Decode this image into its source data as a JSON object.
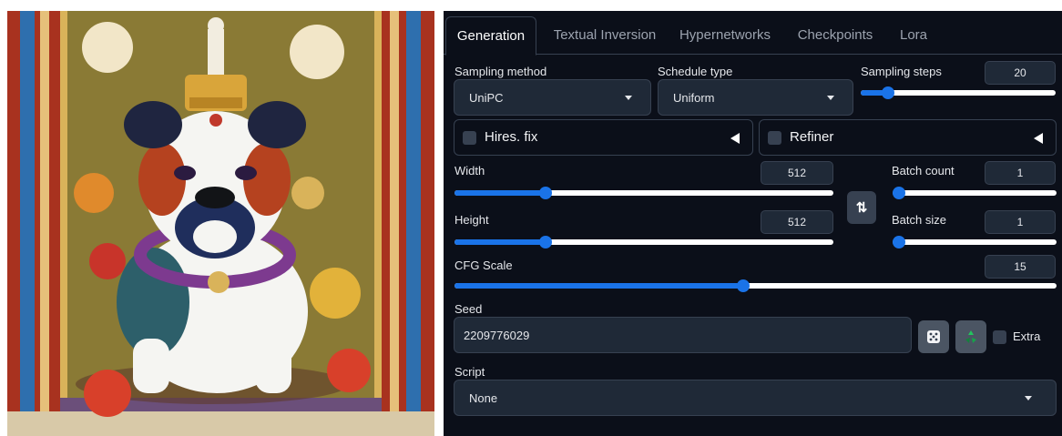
{
  "tabs": [
    "Generation",
    "Textual Inversion",
    "Hypernetworks",
    "Checkpoints",
    "Lora"
  ],
  "selected_tab": "Generation",
  "sampling_method": {
    "label": "Sampling method",
    "value": "UniPC"
  },
  "schedule_type": {
    "label": "Schedule type",
    "value": "Uniform"
  },
  "sampling_steps": {
    "label": "Sampling steps",
    "value": "20",
    "fraction": 0.14
  },
  "hires_fix": {
    "label": "Hires. fix",
    "checked": false
  },
  "refiner": {
    "label": "Refiner",
    "checked": false
  },
  "width": {
    "label": "Width",
    "value": "512",
    "fraction": 0.24
  },
  "height": {
    "label": "Height",
    "value": "512",
    "fraction": 0.24
  },
  "batch_count": {
    "label": "Batch count",
    "value": "1",
    "fraction": 0.0
  },
  "batch_size": {
    "label": "Batch size",
    "value": "1",
    "fraction": 0.0
  },
  "swap_button": {
    "icon": "swap-dimensions-icon",
    "glyph": "⇅"
  },
  "cfg_scale": {
    "label": "CFG Scale",
    "value": "15",
    "fraction": 0.48
  },
  "seed": {
    "label": "Seed",
    "value": "2209776029"
  },
  "random_seed_button": {
    "icon": "dice-icon"
  },
  "reuse_seed_button": {
    "icon": "recycle-icon"
  },
  "extra": {
    "label": "Extra",
    "checked": false
  },
  "script": {
    "label": "Script",
    "value": "None"
  },
  "colors": {
    "accent": "#1a73e8",
    "panel_bg": "#0b0f19",
    "input_bg": "#1f2937",
    "border": "#374151"
  },
  "image": {
    "subject": "bulldog wearing a golden crown",
    "icon": "generated-image"
  }
}
